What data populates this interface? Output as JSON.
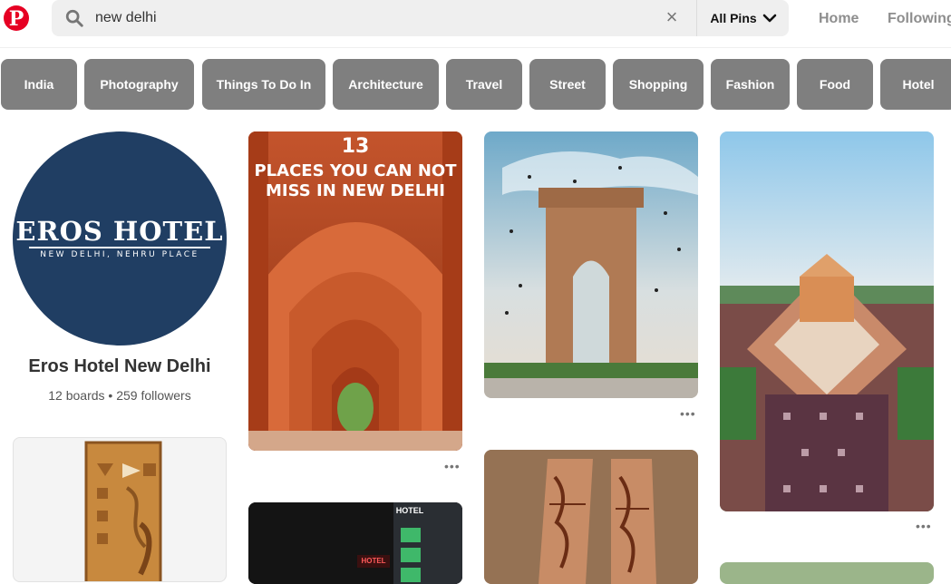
{
  "header": {
    "logo_letter": "P",
    "search_value": "new delhi",
    "clear_symbol": "×",
    "scope_label": "All Pins",
    "nav": {
      "home": "Home",
      "following": "Following"
    }
  },
  "chips": [
    "India",
    "Photography",
    "Things To Do In",
    "Architecture",
    "Travel",
    "Street",
    "Shopping",
    "Fashion",
    "Food",
    "Hotel"
  ],
  "profile": {
    "logo_title": "EROS HOTEL",
    "logo_subtitle": "NEW DELHI, NEHRU PLACE",
    "name": "Eros Hotel New Delhi",
    "stats": "12 boards • 259 followers"
  },
  "pins": {
    "red_fort": {
      "number": "13",
      "line1": "PLACES YOU CAN NOT",
      "line2": "MISS IN NEW DELHI"
    },
    "hotel_sign": "HOTEL",
    "more": "•••"
  }
}
